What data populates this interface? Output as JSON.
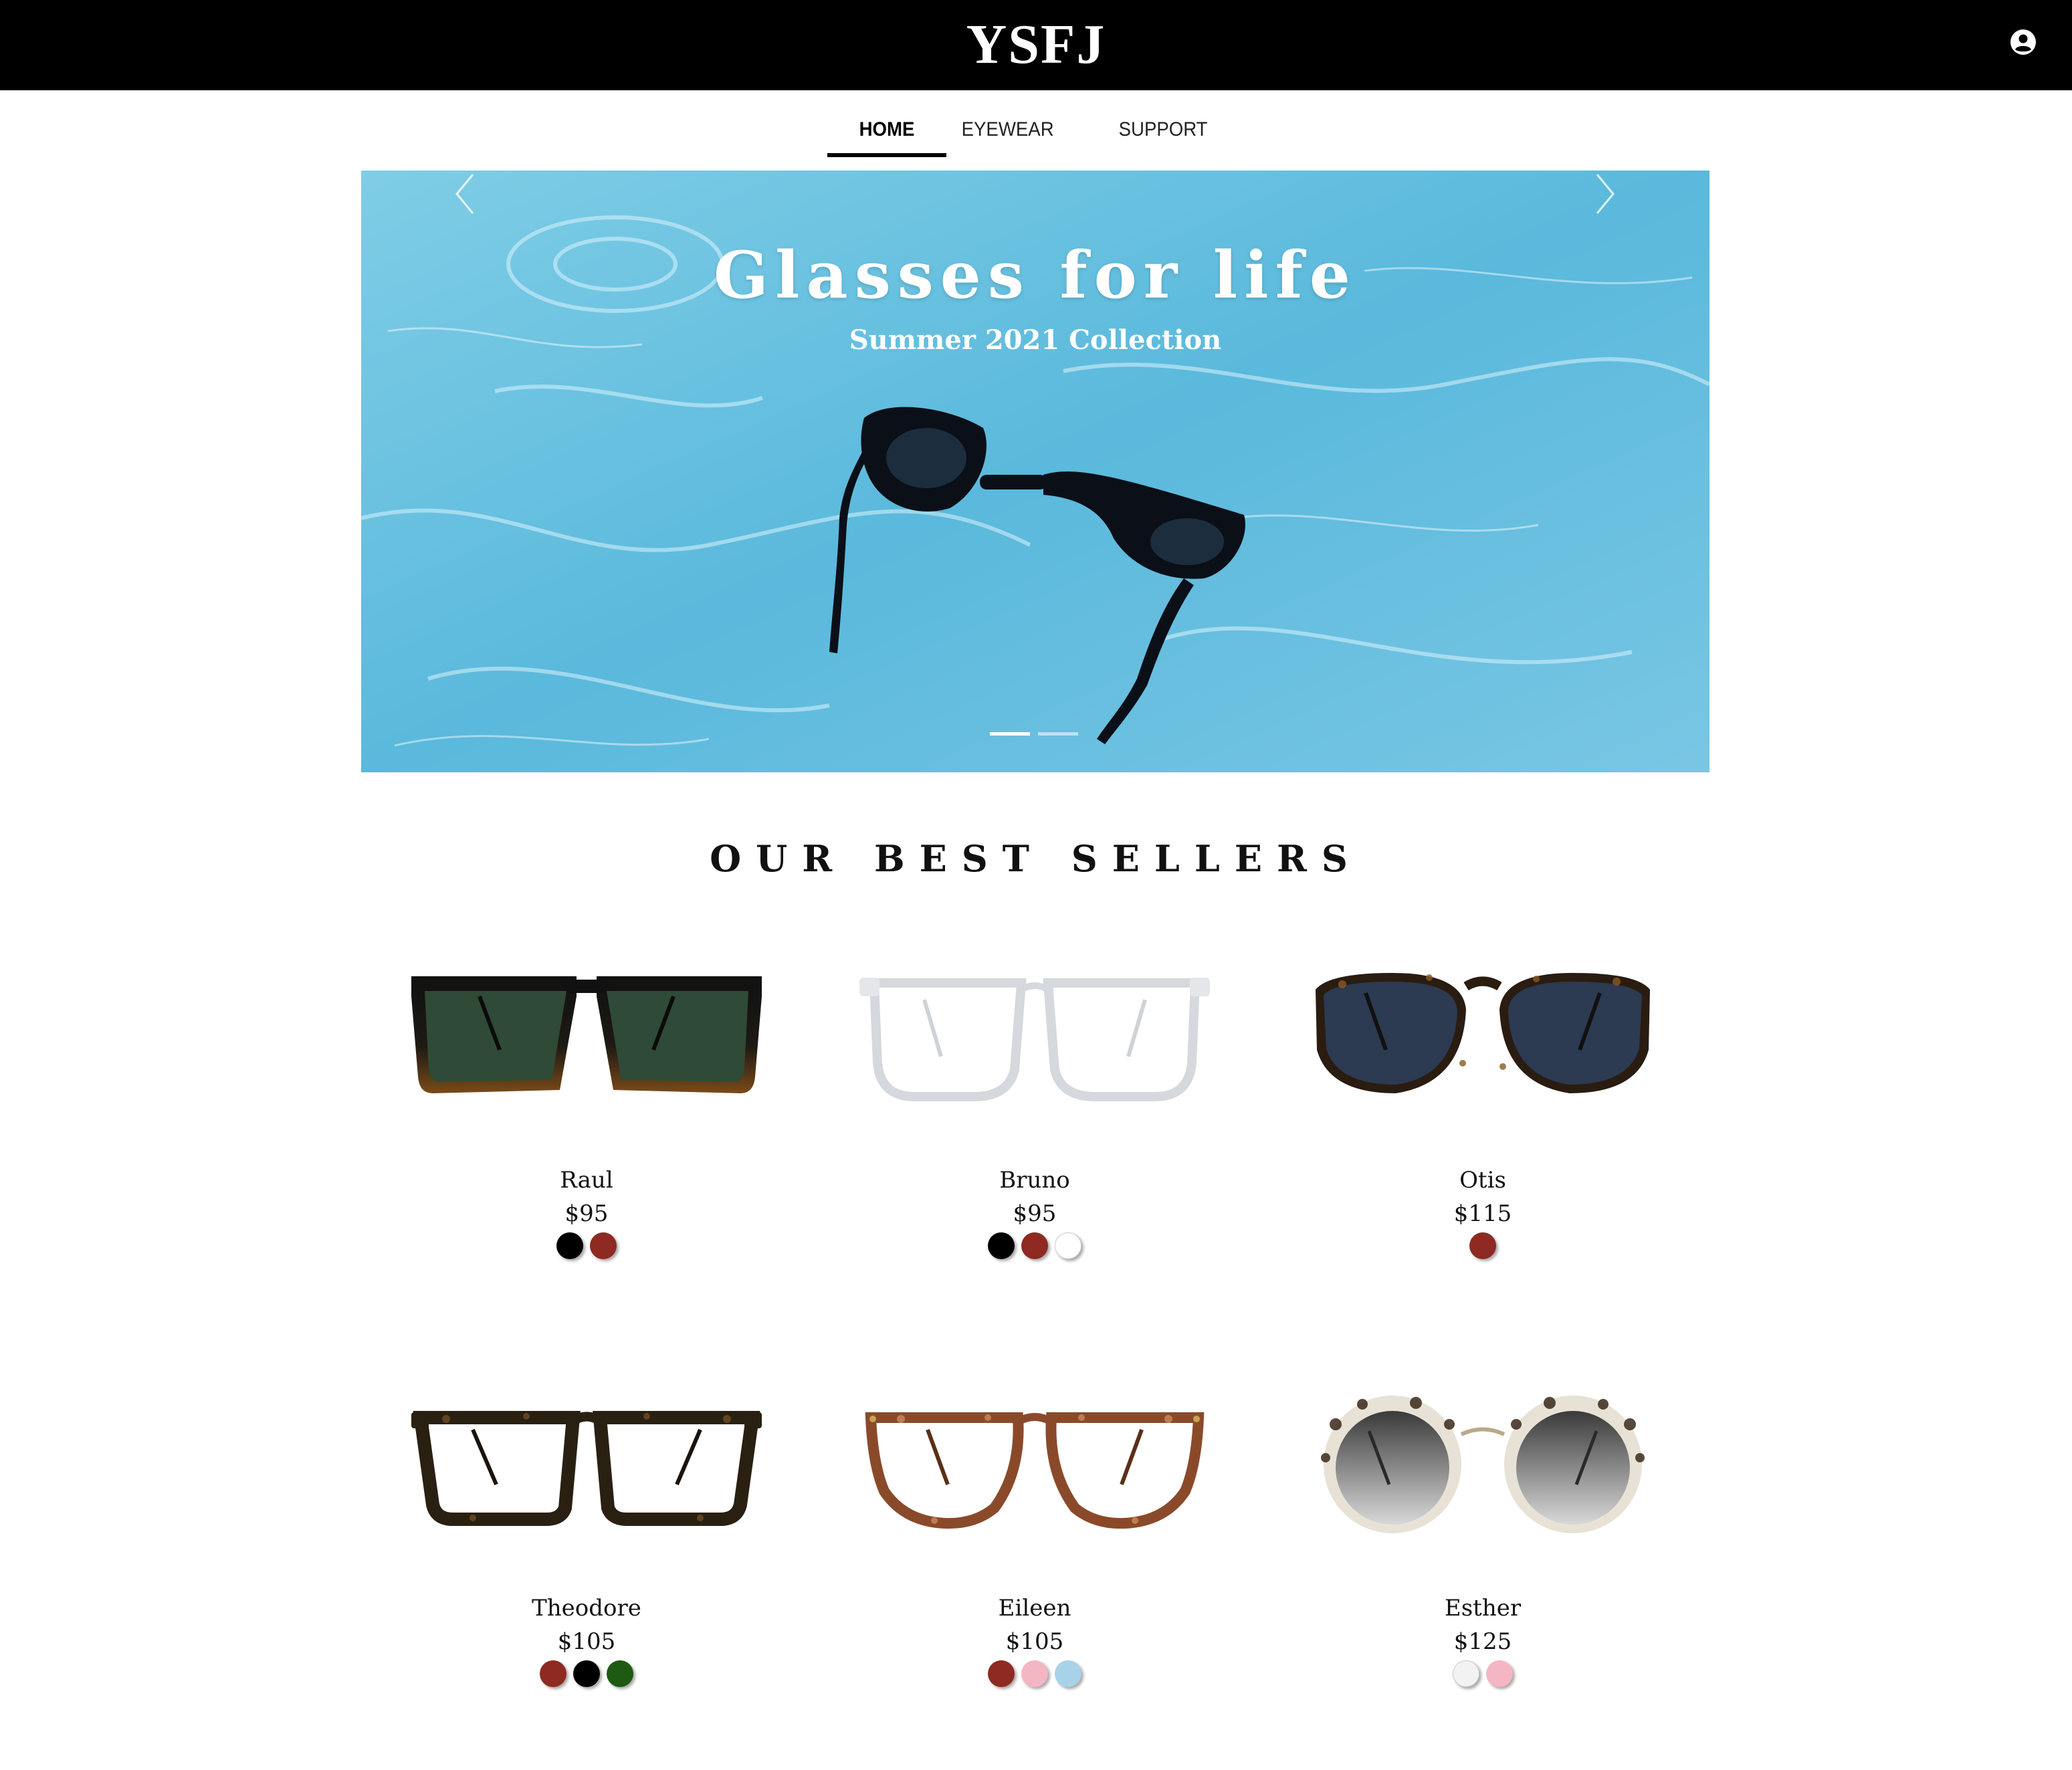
{
  "header": {
    "logo": "YSFJ",
    "account_icon": "user-circle-icon",
    "background": "#000000"
  },
  "nav": {
    "items": [
      {
        "label": "HOME",
        "active": true
      },
      {
        "label": "EYEWEAR",
        "active": false
      },
      {
        "label": "SUPPORT",
        "active": false
      }
    ]
  },
  "hero": {
    "title": "Glasses for life",
    "subtitle": "Summer 2021 Collection",
    "prev_icon": "chevron-left-icon",
    "next_icon": "chevron-right-icon",
    "slide_count": 2,
    "active_slide": 1
  },
  "best_sellers": {
    "title": "OUR BEST SELLERS",
    "products": [
      {
        "name": "Raul",
        "price": "$95",
        "colors": [
          "#000000",
          "#8e2a22"
        ]
      },
      {
        "name": "Bruno",
        "price": "$95",
        "colors": [
          "#000000",
          "#8e2a22",
          "#ffffff"
        ]
      },
      {
        "name": "Otis",
        "price": "$115",
        "colors": [
          "#8e2a22"
        ]
      },
      {
        "name": "Theodore",
        "price": "$105",
        "colors": [
          "#8e2a22",
          "#000000",
          "#1f5a12"
        ]
      },
      {
        "name": "Eileen",
        "price": "$105",
        "colors": [
          "#8e2a22",
          "#f4b6c2",
          "#a8d2e8"
        ]
      },
      {
        "name": "Esther",
        "price": "$125",
        "colors": [
          "#f2f2f2",
          "#f4b6c2"
        ]
      }
    ]
  }
}
